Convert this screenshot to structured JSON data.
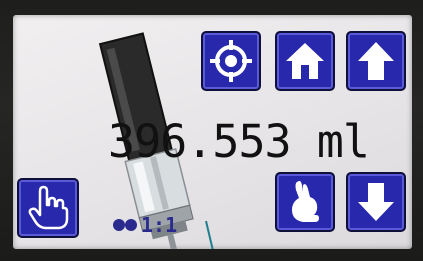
{
  "display": {
    "volume_value": "396.553",
    "volume_unit": "ml",
    "ratio_label": "1:1"
  },
  "buttons": {
    "target": {
      "icon": "crosshair-icon"
    },
    "home": {
      "icon": "home-icon"
    },
    "up": {
      "icon": "arrow-up-icon"
    },
    "manual": {
      "icon": "hand-pointer-icon"
    },
    "speed": {
      "icon": "rabbit-icon"
    },
    "down": {
      "icon": "arrow-down-icon"
    }
  },
  "colors": {
    "button_fill": "#2828ad",
    "button_border": "#0f0f3c",
    "screen_background": "#eceaec",
    "text": "#111111",
    "ratio_text": "#2a2a8e"
  }
}
